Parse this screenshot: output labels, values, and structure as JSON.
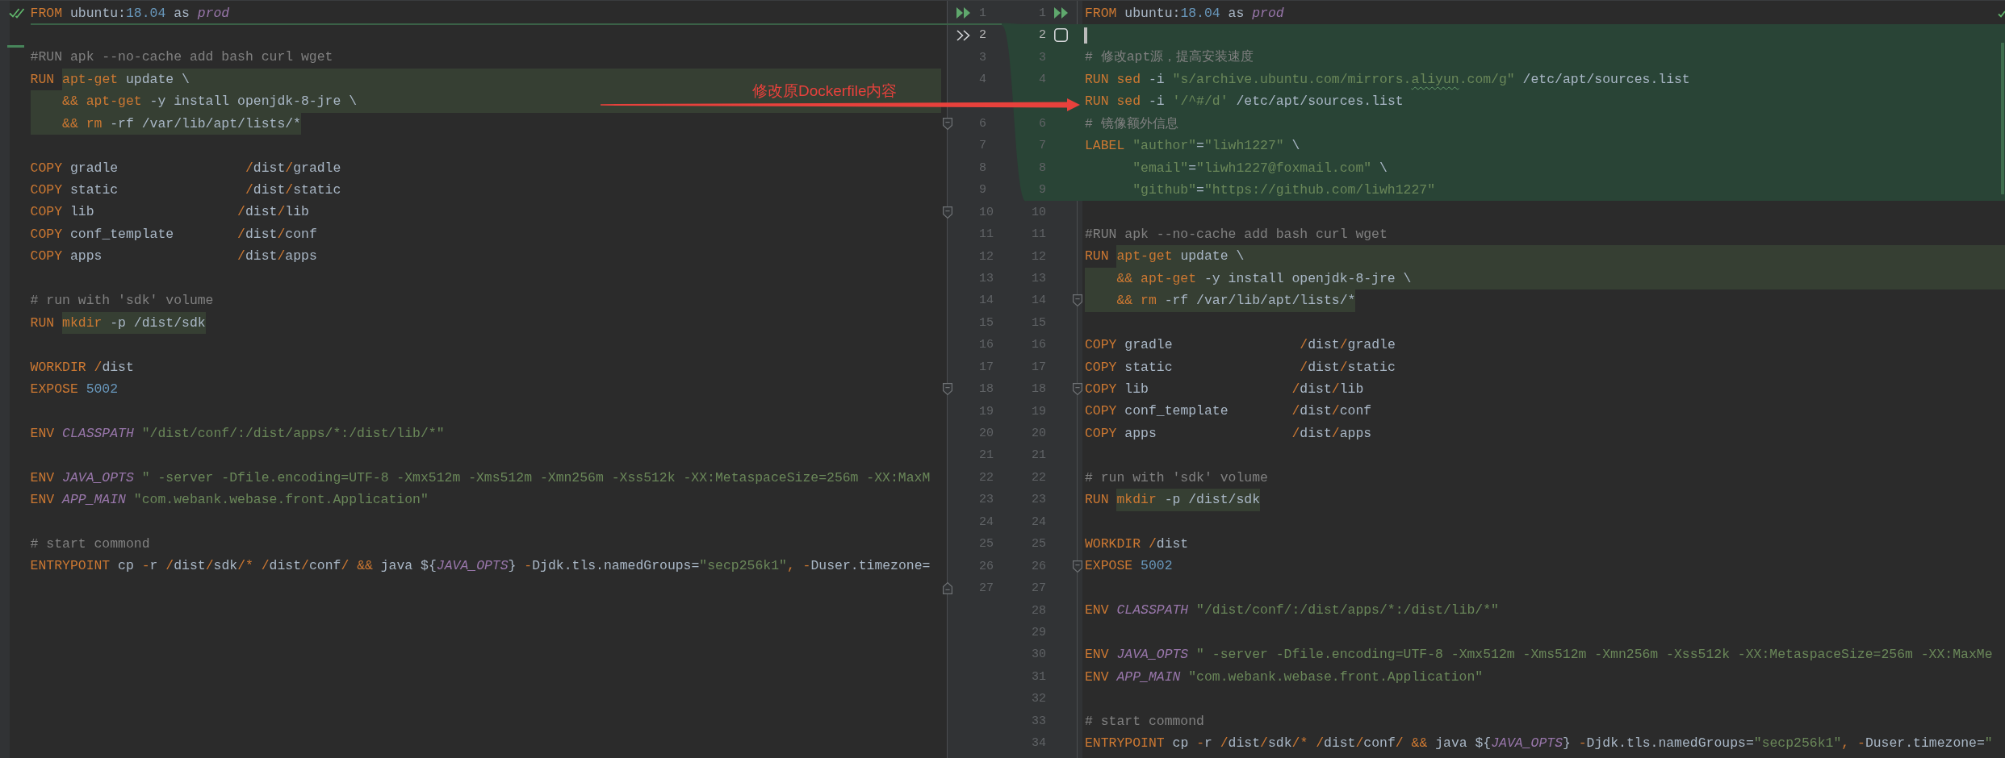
{
  "left_editor": {
    "lines": [
      {
        "number": "1",
        "current": false,
        "insert_below": true,
        "gutter_action": {
          "kind": "apply"
        },
        "tokens": [
          {
            "kind": "keyword",
            "text": "FROM"
          },
          {
            "kind": "plain",
            "text": " ubuntu:"
          },
          {
            "kind": "number",
            "text": "18.04"
          },
          {
            "kind": "plain",
            "text": " as "
          },
          {
            "kind": "variable",
            "text": "prod"
          }
        ]
      },
      {
        "number": "2",
        "current": true,
        "insert_below": false,
        "gutter_action": {
          "kind": "chevrons"
        }
      },
      {
        "number": "3",
        "current": false,
        "insert_below": false,
        "tokens": [
          {
            "kind": "comment",
            "text": "#RUN apk --no-cache add bash curl wget"
          }
        ]
      },
      {
        "number": "4",
        "current": false,
        "insert_below": false,
        "tokens": [
          {
            "kind": "keyword",
            "text": "RUN "
          }
        ],
        "highlight": [
          {
            "kind": "keyword",
            "text": "apt-get"
          },
          {
            "kind": "plain",
            "text": " update \\"
          }
        ]
      },
      {
        "insert_below": false,
        "highlight": [
          {
            "kind": "keyword",
            "text": "    && apt-get"
          },
          {
            "kind": "plain",
            "text": " -y install openjdk-8-jre \\"
          }
        ]
      },
      {
        "number": "6",
        "current": false,
        "insert_below": false,
        "fold": {
          "kind": "start"
        },
        "highlight": [
          {
            "kind": "keyword",
            "text": "    && rm"
          },
          {
            "kind": "plain",
            "text": " -rf /var/lib/apt/lists/*"
          }
        ]
      },
      {
        "number": "7",
        "current": false,
        "insert_below": false
      },
      {
        "number": "8",
        "current": false,
        "insert_below": false,
        "tokens": [
          {
            "kind": "keyword",
            "text": "COPY"
          },
          {
            "kind": "plain",
            "text": " gradle                "
          },
          {
            "kind": "keyword",
            "text": "/"
          },
          {
            "kind": "plain",
            "text": "dist"
          },
          {
            "kind": "keyword",
            "text": "/"
          },
          {
            "kind": "plain",
            "text": "gradle"
          }
        ]
      },
      {
        "number": "9",
        "current": false,
        "insert_below": false,
        "tokens": [
          {
            "kind": "keyword",
            "text": "COPY"
          },
          {
            "kind": "plain",
            "text": " static                "
          },
          {
            "kind": "keyword",
            "text": "/"
          },
          {
            "kind": "plain",
            "text": "dist"
          },
          {
            "kind": "keyword",
            "text": "/"
          },
          {
            "kind": "plain",
            "text": "static"
          }
        ]
      },
      {
        "number": "10",
        "current": false,
        "insert_below": false,
        "fold": {
          "kind": "start"
        },
        "tokens": [
          {
            "kind": "keyword",
            "text": "COPY"
          },
          {
            "kind": "plain",
            "text": " lib                  "
          },
          {
            "kind": "keyword",
            "text": "/"
          },
          {
            "kind": "plain",
            "text": "dist"
          },
          {
            "kind": "keyword",
            "text": "/"
          },
          {
            "kind": "plain",
            "text": "lib"
          }
        ]
      },
      {
        "number": "11",
        "current": false,
        "insert_below": false,
        "tokens": [
          {
            "kind": "keyword",
            "text": "COPY"
          },
          {
            "kind": "plain",
            "text": " conf_template        "
          },
          {
            "kind": "keyword",
            "text": "/"
          },
          {
            "kind": "plain",
            "text": "dist"
          },
          {
            "kind": "keyword",
            "text": "/"
          },
          {
            "kind": "plain",
            "text": "conf"
          }
        ]
      },
      {
        "number": "12",
        "current": false,
        "insert_below": false,
        "tokens": [
          {
            "kind": "keyword",
            "text": "COPY"
          },
          {
            "kind": "plain",
            "text": " apps                 "
          },
          {
            "kind": "keyword",
            "text": "/"
          },
          {
            "kind": "plain",
            "text": "dist"
          },
          {
            "kind": "keyword",
            "text": "/"
          },
          {
            "kind": "plain",
            "text": "apps"
          }
        ]
      },
      {
        "number": "13",
        "current": false,
        "insert_below": false
      },
      {
        "number": "14",
        "current": false,
        "insert_below": false,
        "tokens": [
          {
            "kind": "comment",
            "text": "# run with 'sdk' volume"
          }
        ]
      },
      {
        "number": "15",
        "current": false,
        "insert_below": false,
        "tokens": [
          {
            "kind": "keyword",
            "text": "RUN "
          }
        ],
        "highlight": [
          {
            "kind": "keyword",
            "text": "mkdir"
          },
          {
            "kind": "plain",
            "text": " -p /dist/sdk"
          }
        ]
      },
      {
        "number": "16",
        "current": false,
        "insert_below": false
      },
      {
        "number": "17",
        "current": false,
        "insert_below": false,
        "tokens": [
          {
            "kind": "keyword",
            "text": "WORKDIR /"
          },
          {
            "kind": "plain",
            "text": "dist"
          }
        ]
      },
      {
        "number": "18",
        "current": false,
        "insert_below": false,
        "fold": {
          "kind": "start"
        },
        "tokens": [
          {
            "kind": "keyword",
            "text": "EXPOSE"
          },
          {
            "kind": "number",
            "text": " 5002"
          }
        ]
      },
      {
        "number": "19",
        "current": false,
        "insert_below": false
      },
      {
        "number": "20",
        "current": false,
        "insert_below": false,
        "tokens": [
          {
            "kind": "keyword",
            "text": "ENV"
          },
          {
            "kind": "variable",
            "text": " CLASSPATH"
          },
          {
            "kind": "string",
            "text": " \"/dist/conf/:/dist/apps/*:/dist/lib/*\""
          }
        ]
      },
      {
        "number": "21",
        "current": false,
        "insert_below": false
      },
      {
        "number": "22",
        "current": false,
        "insert_below": false,
        "tokens": [
          {
            "kind": "keyword",
            "text": "ENV"
          },
          {
            "kind": "variable",
            "text": " JAVA_OPTS"
          },
          {
            "kind": "string",
            "text": " \" -server -Dfile.encoding=UTF-8 -Xmx512m -Xms512m -Xmn256m -Xss512k -XX:MetaspaceSize=256m -XX:MaxM"
          }
        ]
      },
      {
        "number": "23",
        "current": false,
        "insert_below": false,
        "tokens": [
          {
            "kind": "keyword",
            "text": "ENV"
          },
          {
            "kind": "variable",
            "text": " APP_MAIN"
          },
          {
            "kind": "string",
            "text": " \"com.webank.webase.front.Application\""
          }
        ]
      },
      {
        "number": "24",
        "current": false,
        "insert_below": false
      },
      {
        "number": "25",
        "current": false,
        "insert_below": false,
        "tokens": [
          {
            "kind": "comment",
            "text": "# start commond"
          }
        ]
      },
      {
        "number": "26",
        "current": false,
        "insert_below": false,
        "tokens": [
          {
            "kind": "keyword",
            "text": "ENTRYPOINT"
          },
          {
            "kind": "plain",
            "text": " cp "
          },
          {
            "kind": "keyword",
            "text": "-"
          },
          {
            "kind": "plain",
            "text": "r "
          },
          {
            "kind": "keyword",
            "text": "/"
          },
          {
            "kind": "plain",
            "text": "dist"
          },
          {
            "kind": "keyword",
            "text": "/"
          },
          {
            "kind": "plain",
            "text": "sdk"
          },
          {
            "kind": "keyword",
            "text": "/* /"
          },
          {
            "kind": "plain",
            "text": "dist"
          },
          {
            "kind": "keyword",
            "text": "/"
          },
          {
            "kind": "plain",
            "text": "conf"
          },
          {
            "kind": "keyword",
            "text": "/ &&"
          },
          {
            "kind": "plain",
            "text": " java ${"
          },
          {
            "kind": "variable",
            "text": "JAVA_OPTS"
          },
          {
            "kind": "plain",
            "text": "} "
          },
          {
            "kind": "keyword",
            "text": "-"
          },
          {
            "kind": "plain",
            "text": "Djdk.tls.namedGroups="
          },
          {
            "kind": "string",
            "text": "\"secp256k1\""
          },
          {
            "kind": "keyword",
            "text": ", -"
          },
          {
            "kind": "plain",
            "text": "Duser.timezone="
          }
        ]
      },
      {
        "number": "27",
        "current": false,
        "insert_below": false,
        "fold": {
          "kind": "end"
        }
      }
    ]
  },
  "right_editor": {
    "lines": [
      {
        "number": "1",
        "current": false,
        "inserted": false,
        "caret": false,
        "gutter_action": {
          "kind": "apply"
        },
        "tokens": [
          {
            "kind": "keyword",
            "text": "FROM"
          },
          {
            "kind": "plain",
            "text": " ubuntu:"
          },
          {
            "kind": "number",
            "text": "18.04"
          },
          {
            "kind": "plain",
            "text": " as "
          },
          {
            "kind": "variable",
            "text": "prod"
          }
        ]
      },
      {
        "number": "2",
        "current": true,
        "inserted": true,
        "caret": true,
        "gutter_action": {
          "kind": "checkbox",
          "checked": false
        }
      },
      {
        "number": "3",
        "current": false,
        "inserted": true,
        "caret": false,
        "tokens": [
          {
            "kind": "comment",
            "text": "# 修改apt源，提高安装速度"
          }
        ]
      },
      {
        "number": "4",
        "current": false,
        "inserted": true,
        "caret": false,
        "tokens": [
          {
            "kind": "keyword",
            "text": "RUN sed"
          },
          {
            "kind": "plain",
            "text": " -i "
          },
          {
            "kind": "string",
            "text": "\"s/archive.ubuntu.com/mirrors."
          },
          {
            "kind": "string-typo",
            "text": "aliyun"
          },
          {
            "kind": "string",
            "text": ".com/g\""
          },
          {
            "kind": "plain",
            "text": " /etc/apt/sources.list"
          }
        ]
      },
      {
        "inserted": true,
        "caret": false,
        "tokens": [
          {
            "kind": "keyword",
            "text": "RUN sed"
          },
          {
            "kind": "plain",
            "text": " -i "
          },
          {
            "kind": "string",
            "text": "'/^#/d'"
          },
          {
            "kind": "plain",
            "text": " /etc/apt/sources.list"
          }
        ]
      },
      {
        "number": "6",
        "current": false,
        "inserted": true,
        "caret": false,
        "tokens": [
          {
            "kind": "comment",
            "text": "# 镜像额外信息"
          }
        ]
      },
      {
        "number": "7",
        "current": false,
        "inserted": true,
        "caret": false,
        "tokens": [
          {
            "kind": "keyword",
            "text": "LABEL"
          },
          {
            "kind": "string",
            "text": " \"author\""
          },
          {
            "kind": "plain",
            "text": "="
          },
          {
            "kind": "string",
            "text": "\"liwh1227\""
          },
          {
            "kind": "plain",
            "text": " \\"
          }
        ]
      },
      {
        "number": "8",
        "current": false,
        "inserted": true,
        "caret": false,
        "tokens": [
          {
            "kind": "string",
            "text": "      \"email\""
          },
          {
            "kind": "plain",
            "text": "="
          },
          {
            "kind": "string",
            "text": "\"liwh1227@foxmail.com\""
          },
          {
            "kind": "plain",
            "text": " \\"
          }
        ]
      },
      {
        "number": "9",
        "current": false,
        "inserted": true,
        "caret": false,
        "tokens": [
          {
            "kind": "string",
            "text": "      \"github\""
          },
          {
            "kind": "plain",
            "text": "="
          },
          {
            "kind": "string",
            "text": "\"https://github.com/liwh1227\""
          }
        ]
      },
      {
        "number": "10",
        "current": false,
        "inserted": false,
        "caret": false
      },
      {
        "number": "11",
        "current": false,
        "inserted": false,
        "caret": false,
        "tokens": [
          {
            "kind": "comment",
            "text": "#RUN apk --no-cache add bash curl wget"
          }
        ]
      },
      {
        "number": "12",
        "current": false,
        "inserted": false,
        "caret": false,
        "tokens": [
          {
            "kind": "keyword",
            "text": "RUN "
          }
        ],
        "highlight": [
          {
            "kind": "keyword",
            "text": "apt-get"
          },
          {
            "kind": "plain",
            "text": " update \\"
          }
        ]
      },
      {
        "number": "13",
        "current": false,
        "inserted": false,
        "caret": false,
        "highlight": [
          {
            "kind": "keyword",
            "text": "    && apt-get"
          },
          {
            "kind": "plain",
            "text": " -y install openjdk-8-jre \\"
          }
        ]
      },
      {
        "number": "14",
        "current": false,
        "inserted": false,
        "caret": false,
        "fold": {
          "kind": "start"
        },
        "highlight": [
          {
            "kind": "keyword",
            "text": "    && rm"
          },
          {
            "kind": "plain",
            "text": " -rf /var/lib/apt/lists/*"
          }
        ]
      },
      {
        "number": "15",
        "current": false,
        "inserted": false,
        "caret": false
      },
      {
        "number": "16",
        "current": false,
        "inserted": false,
        "caret": false,
        "tokens": [
          {
            "kind": "keyword",
            "text": "COPY"
          },
          {
            "kind": "plain",
            "text": " gradle                "
          },
          {
            "kind": "keyword",
            "text": "/"
          },
          {
            "kind": "plain",
            "text": "dist"
          },
          {
            "kind": "keyword",
            "text": "/"
          },
          {
            "kind": "plain",
            "text": "gradle"
          }
        ]
      },
      {
        "number": "17",
        "current": false,
        "inserted": false,
        "caret": false,
        "tokens": [
          {
            "kind": "keyword",
            "text": "COPY"
          },
          {
            "kind": "plain",
            "text": " static                "
          },
          {
            "kind": "keyword",
            "text": "/"
          },
          {
            "kind": "plain",
            "text": "dist"
          },
          {
            "kind": "keyword",
            "text": "/"
          },
          {
            "kind": "plain",
            "text": "static"
          }
        ]
      },
      {
        "number": "18",
        "current": false,
        "inserted": false,
        "caret": false,
        "fold": {
          "kind": "start"
        },
        "tokens": [
          {
            "kind": "keyword",
            "text": "COPY"
          },
          {
            "kind": "plain",
            "text": " lib                  "
          },
          {
            "kind": "keyword",
            "text": "/"
          },
          {
            "kind": "plain",
            "text": "dist"
          },
          {
            "kind": "keyword",
            "text": "/"
          },
          {
            "kind": "plain",
            "text": "lib"
          }
        ]
      },
      {
        "number": "19",
        "current": false,
        "inserted": false,
        "caret": false,
        "tokens": [
          {
            "kind": "keyword",
            "text": "COPY"
          },
          {
            "kind": "plain",
            "text": " conf_template        "
          },
          {
            "kind": "keyword",
            "text": "/"
          },
          {
            "kind": "plain",
            "text": "dist"
          },
          {
            "kind": "keyword",
            "text": "/"
          },
          {
            "kind": "plain",
            "text": "conf"
          }
        ]
      },
      {
        "number": "20",
        "current": false,
        "inserted": false,
        "caret": false,
        "tokens": [
          {
            "kind": "keyword",
            "text": "COPY"
          },
          {
            "kind": "plain",
            "text": " apps                 "
          },
          {
            "kind": "keyword",
            "text": "/"
          },
          {
            "kind": "plain",
            "text": "dist"
          },
          {
            "kind": "keyword",
            "text": "/"
          },
          {
            "kind": "plain",
            "text": "apps"
          }
        ]
      },
      {
        "number": "21",
        "current": false,
        "inserted": false,
        "caret": false
      },
      {
        "number": "22",
        "current": false,
        "inserted": false,
        "caret": false,
        "tokens": [
          {
            "kind": "comment",
            "text": "# run with 'sdk' volume"
          }
        ]
      },
      {
        "number": "23",
        "current": false,
        "inserted": false,
        "caret": false,
        "tokens": [
          {
            "kind": "keyword",
            "text": "RUN "
          }
        ],
        "highlight": [
          {
            "kind": "keyword",
            "text": "mkdir"
          },
          {
            "kind": "plain",
            "text": " -p /dist/sdk"
          }
        ]
      },
      {
        "number": "24",
        "current": false,
        "inserted": false,
        "caret": false
      },
      {
        "number": "25",
        "current": false,
        "inserted": false,
        "caret": false,
        "tokens": [
          {
            "kind": "keyword",
            "text": "WORKDIR /"
          },
          {
            "kind": "plain",
            "text": "dist"
          }
        ]
      },
      {
        "number": "26",
        "current": false,
        "inserted": false,
        "caret": false,
        "fold": {
          "kind": "start"
        },
        "tokens": [
          {
            "kind": "keyword",
            "text": "EXPOSE"
          },
          {
            "kind": "number",
            "text": " 5002"
          }
        ]
      },
      {
        "number": "27",
        "current": false,
        "inserted": false,
        "caret": false
      },
      {
        "number": "28",
        "current": false,
        "inserted": false,
        "caret": false,
        "tokens": [
          {
            "kind": "keyword",
            "text": "ENV"
          },
          {
            "kind": "variable",
            "text": " CLASSPATH"
          },
          {
            "kind": "string",
            "text": " \"/dist/conf/:/dist/apps/*:/dist/lib/*\""
          }
        ]
      },
      {
        "number": "29",
        "current": false,
        "inserted": false,
        "caret": false
      },
      {
        "number": "30",
        "current": false,
        "inserted": false,
        "caret": false,
        "tokens": [
          {
            "kind": "keyword",
            "text": "ENV"
          },
          {
            "kind": "variable",
            "text": " JAVA_OPTS"
          },
          {
            "kind": "string",
            "text": " \" -server -Dfile.encoding=UTF-8 -Xmx512m -Xms512m -Xmn256m -Xss512k -XX:MetaspaceSize=256m -XX:MaxMe"
          }
        ]
      },
      {
        "number": "31",
        "current": false,
        "inserted": false,
        "caret": false,
        "tokens": [
          {
            "kind": "keyword",
            "text": "ENV"
          },
          {
            "kind": "variable",
            "text": " APP_MAIN"
          },
          {
            "kind": "string",
            "text": " \"com.webank.webase.front.Application\""
          }
        ]
      },
      {
        "number": "32",
        "current": false,
        "inserted": false,
        "caret": false
      },
      {
        "number": "33",
        "current": false,
        "inserted": false,
        "caret": false,
        "tokens": [
          {
            "kind": "comment",
            "text": "# start commond"
          }
        ]
      },
      {
        "number": "34",
        "current": false,
        "inserted": false,
        "caret": false,
        "tokens": [
          {
            "kind": "keyword",
            "text": "ENTRYPOINT"
          },
          {
            "kind": "plain",
            "text": " cp "
          },
          {
            "kind": "keyword",
            "text": "-"
          },
          {
            "kind": "plain",
            "text": "r "
          },
          {
            "kind": "keyword",
            "text": "/"
          },
          {
            "kind": "plain",
            "text": "dist"
          },
          {
            "kind": "keyword",
            "text": "/"
          },
          {
            "kind": "plain",
            "text": "sdk"
          },
          {
            "kind": "keyword",
            "text": "/* /"
          },
          {
            "kind": "plain",
            "text": "dist"
          },
          {
            "kind": "keyword",
            "text": "/"
          },
          {
            "kind": "plain",
            "text": "conf"
          },
          {
            "kind": "keyword",
            "text": "/ &&"
          },
          {
            "kind": "plain",
            "text": " java ${"
          },
          {
            "kind": "variable",
            "text": "JAVA_OPTS"
          },
          {
            "kind": "plain",
            "text": "} "
          },
          {
            "kind": "keyword",
            "text": "-"
          },
          {
            "kind": "plain",
            "text": "Djdk.tls.namedGroups="
          },
          {
            "kind": "string",
            "text": "\"secp256k1\""
          },
          {
            "kind": "keyword",
            "text": ", -"
          },
          {
            "kind": "plain",
            "text": "Duser.timezone="
          },
          {
            "kind": "string",
            "text": "\""
          }
        ]
      }
    ]
  },
  "annotation": {
    "text": "修改原Dockerfile内容"
  }
}
